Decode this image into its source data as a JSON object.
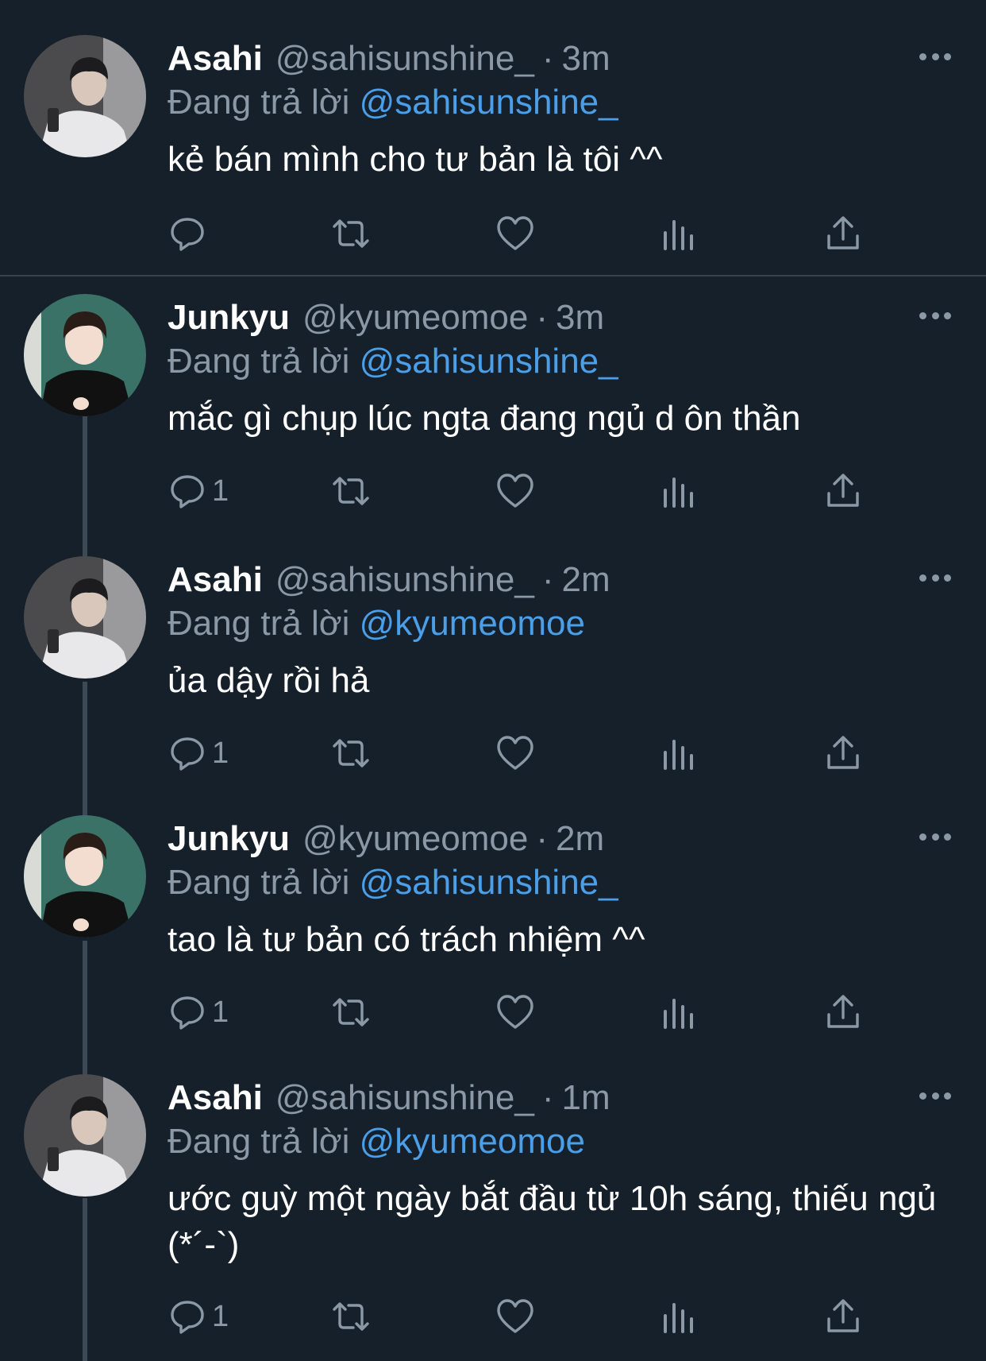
{
  "colors": {
    "background": "#15202b",
    "divider": "#38444d",
    "secondary_text": "#8b98a5",
    "mention": "#4a9fe8",
    "thread_line": "#3d4a55"
  },
  "tweets": [
    {
      "name": "Asahi",
      "handle": "@sahisunshine_",
      "time": "3m",
      "replying_label": "Đang trả lời",
      "replying_to": "@sahisunshine_",
      "text": "kẻ bán mình cho tư bản là tôi ^^",
      "reply_count": "",
      "avatar": "asahi-avatar"
    },
    {
      "name": "Junkyu",
      "handle": "@kyumeomoe",
      "time": "3m",
      "replying_label": "Đang trả lời",
      "replying_to": "@sahisunshine_",
      "text": "mắc gì chụp lúc ngta đang ngủ d ôn thần",
      "reply_count": "1",
      "avatar": "junkyu-avatar"
    },
    {
      "name": "Asahi",
      "handle": "@sahisunshine_",
      "time": "2m",
      "replying_label": "Đang trả lời",
      "replying_to": "@kyumeomoe",
      "text": "ủa dậy rồi hả",
      "reply_count": "1",
      "avatar": "asahi-avatar"
    },
    {
      "name": "Junkyu",
      "handle": "@kyumeomoe",
      "time": "2m",
      "replying_label": "Đang trả lời",
      "replying_to": "@sahisunshine_",
      "text": "tao là tư bản có trách nhiệm ^^",
      "reply_count": "1",
      "avatar": "junkyu-avatar"
    },
    {
      "name": "Asahi",
      "handle": "@sahisunshine_",
      "time": "1m",
      "replying_label": "Đang trả lời",
      "replying_to": "@kyumeomoe",
      "text": "ước guỳ một ngày bắt đầu từ 10h sáng, thiếu ngủ (*´-`)",
      "reply_count": "1",
      "avatar": "asahi-avatar"
    }
  ],
  "separator": "·",
  "icons": [
    "reply-icon",
    "retweet-icon",
    "like-icon",
    "analytics-icon",
    "share-icon",
    "more-icon"
  ]
}
